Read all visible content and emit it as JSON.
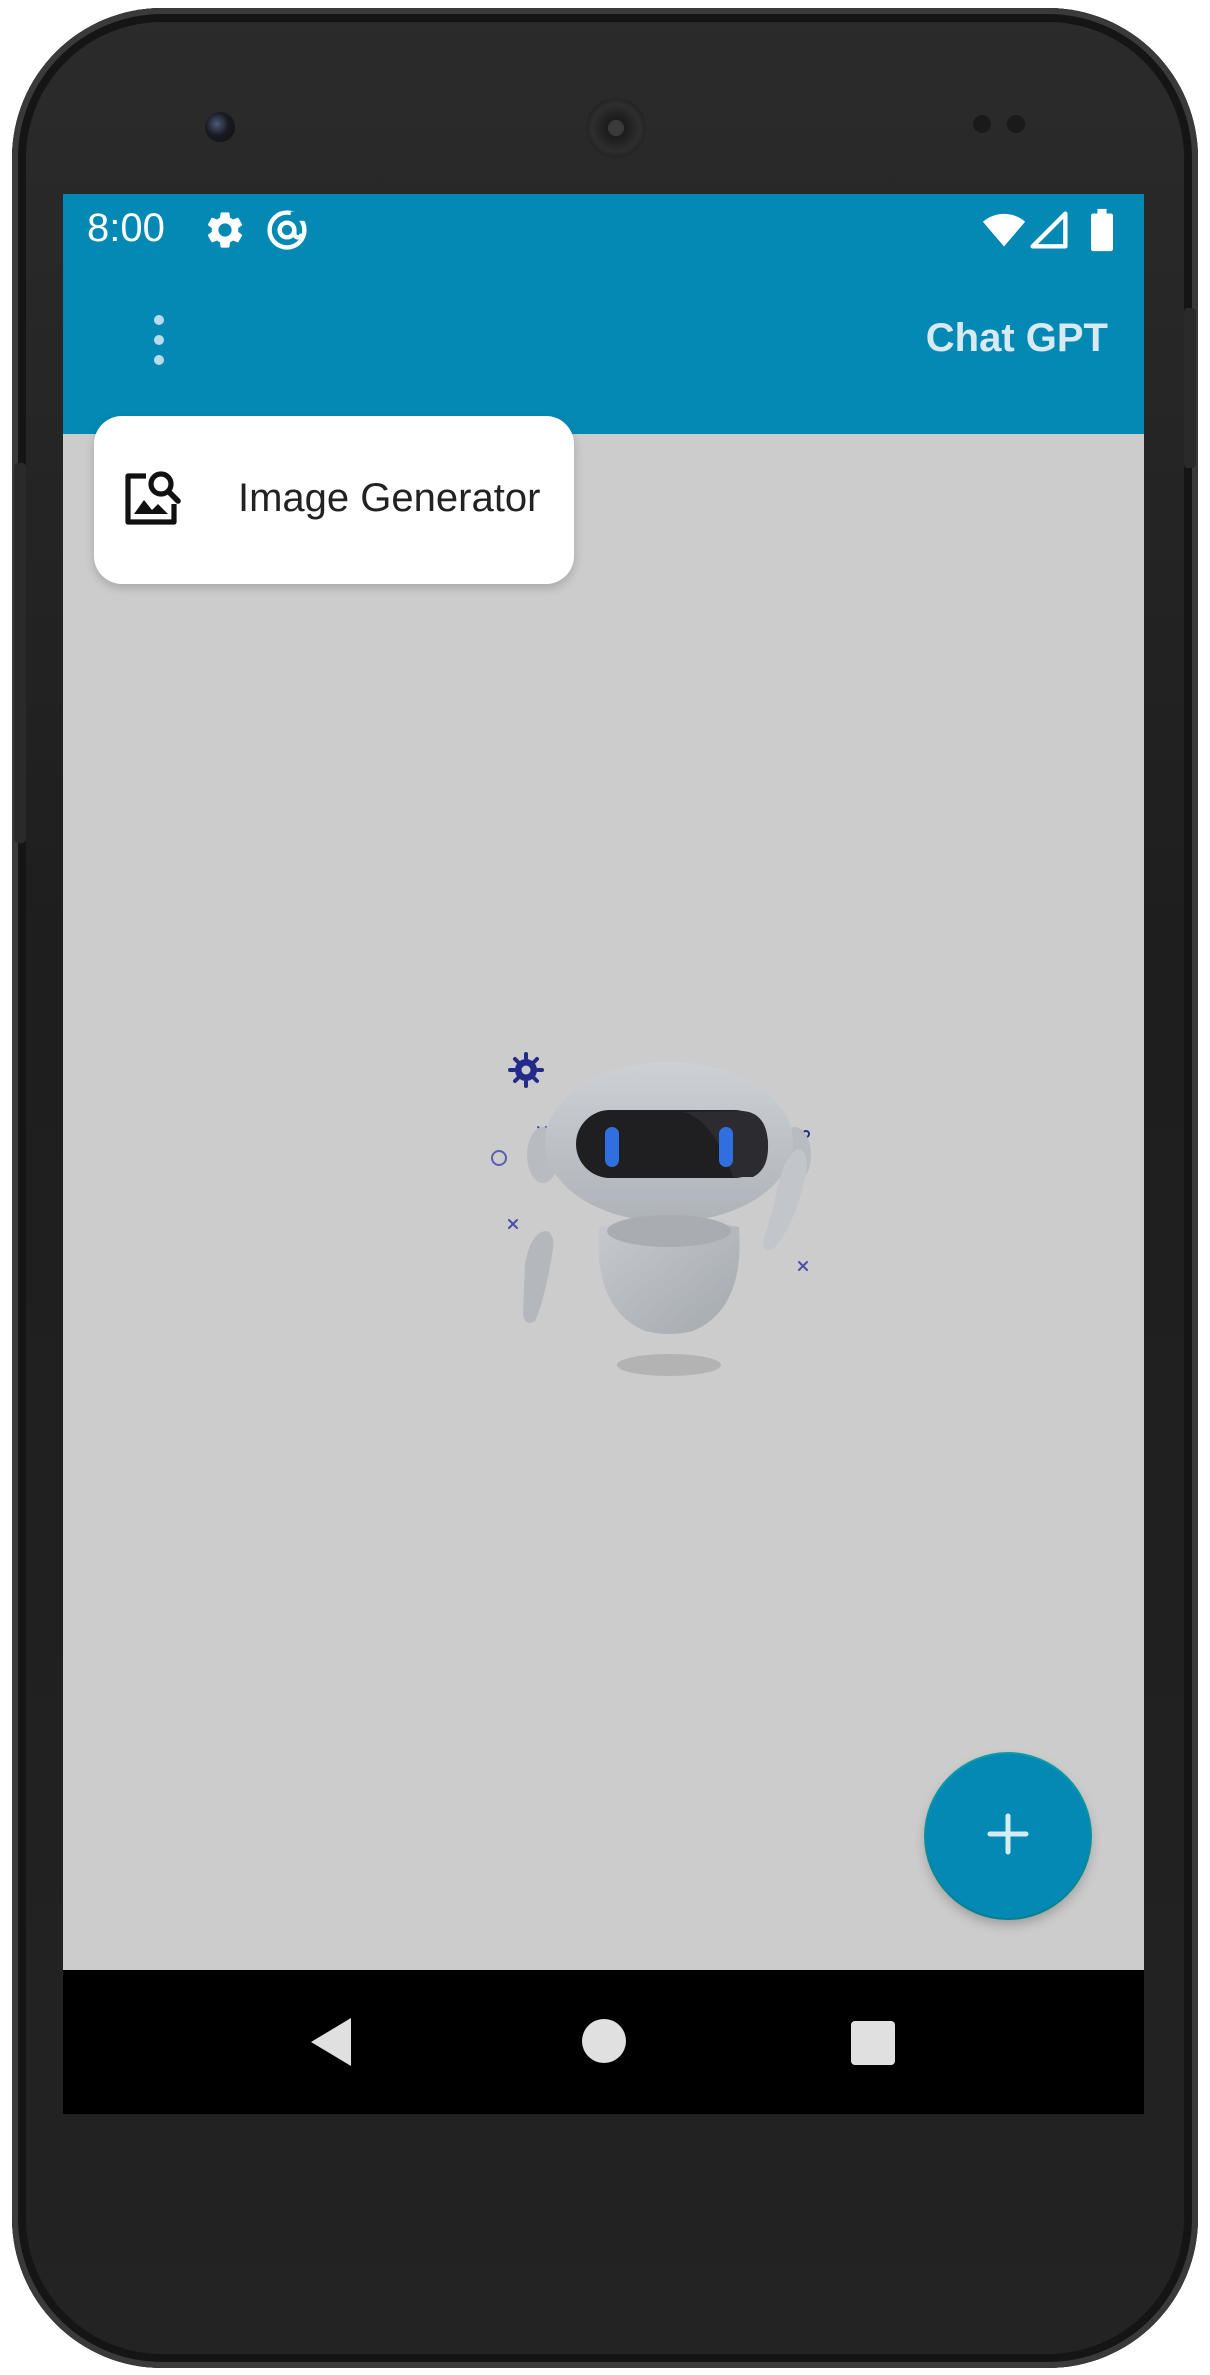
{
  "status_bar": {
    "time": "8:00",
    "color": "#0489b5"
  },
  "app_bar": {
    "title": "Chat GPT",
    "color": "#0489b5"
  },
  "menu": {
    "items": [
      {
        "label": "Image Generator",
        "icon": "image-search-icon"
      }
    ]
  },
  "main": {
    "background": "#cccccc",
    "illustration": "robot-illustration"
  },
  "fab": {
    "icon": "plus-icon",
    "color": "#0489b5"
  },
  "nav_bar": {
    "buttons": [
      "back-icon",
      "home-icon",
      "recents-icon"
    ]
  }
}
